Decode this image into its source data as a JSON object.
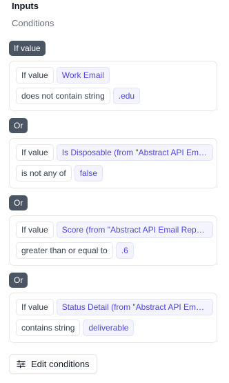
{
  "header": {
    "title": "Inputs",
    "subtitle": "Conditions"
  },
  "conditions": [
    {
      "tag": "If value",
      "field_label": "If value",
      "field": "Work Email",
      "operator": "does not contain string",
      "value": ".edu"
    },
    {
      "tag": "Or",
      "field_label": "If value",
      "field": "Is Disposable (from \"Abstract API Email Validation\")",
      "operator": "is not any of",
      "value": "false"
    },
    {
      "tag": "Or",
      "field_label": "If value",
      "field": "Score (from \"Abstract API Email Reputation\")",
      "operator": "greater than or equal to",
      "value": ".6"
    },
    {
      "tag": "Or",
      "field_label": "If value",
      "field": "Status Detail (from \"Abstract API Email Validation\")",
      "operator": "contains string",
      "value": "deliverable"
    }
  ],
  "edit_button": {
    "label": "Edit conditions",
    "icon": "sliders-icon"
  }
}
